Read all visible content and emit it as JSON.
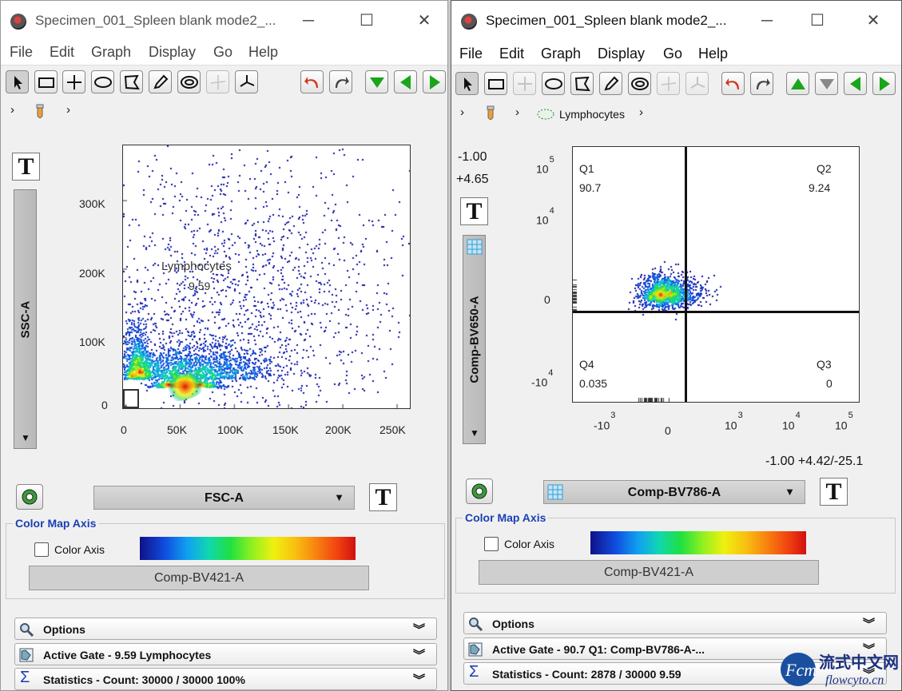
{
  "win1": {
    "title": "Specimen_001_Spleen blank mode2_...",
    "menu": [
      "File",
      "Edit",
      "Graph",
      "Display",
      "Go",
      "Help"
    ],
    "crumb_arrows": [
      "›",
      "›"
    ],
    "yaxis_label": "SSC-A",
    "xaxis_label": "FSC-A",
    "gate_name": "Lymphocytes",
    "gate_pct": "9.59",
    "color_map_title": "Color Map Axis",
    "color_axis_label": "Color Axis",
    "color_param": "Comp-BV421-A",
    "options_label": "Options",
    "active_gate_label": "Active Gate  -  9.59 Lymphocytes",
    "statistics_label": "Statistics  -  Count: 30000 / 30000       100%"
  },
  "win2": {
    "title": "Specimen_001_Spleen blank mode2_...",
    "menu": [
      "File",
      "Edit",
      "Graph",
      "Display",
      "Go",
      "Help"
    ],
    "crumb_arrows": [
      "›",
      "›",
      "›"
    ],
    "crumb_population": "Lymphocytes",
    "readout_y1": "-1.00",
    "readout_y2": "+4.65",
    "readout_x": "-1.00 +4.42/-25.1",
    "yaxis_label": "Comp-BV650-A",
    "xaxis_label": "Comp-BV786-A",
    "quadrants": {
      "q1_name": "Q1",
      "q1_pct": "90.7",
      "q2_name": "Q2",
      "q2_pct": "9.24",
      "q3_name": "Q3",
      "q3_pct": "0",
      "q4_name": "Q4",
      "q4_pct": "0.035"
    },
    "color_map_title": "Color Map Axis",
    "color_axis_label": "Color Axis",
    "color_param": "Comp-BV421-A",
    "options_label": "Options",
    "active_gate_label": "Active Gate  -  90.7 Q1: Comp-BV786-A-...",
    "statistics_label": "Statistics  -  Count: 2878 / 30000       9.59"
  },
  "chart_data": [
    {
      "type": "scatter",
      "xlabel": "FSC-A",
      "ylabel": "SSC-A",
      "x_ticks": [
        "0",
        "50K",
        "100K",
        "150K",
        "200K",
        "250K"
      ],
      "y_ticks": [
        "0",
        "100K",
        "200K",
        "300K"
      ],
      "xlim": [
        0,
        262144
      ],
      "ylim": [
        0,
        380000
      ],
      "density": [
        {
          "x": 55000,
          "y": 28000,
          "spread_x": 14000,
          "spread_y": 9000,
          "n": 900
        },
        {
          "x": 60000,
          "y": 40000,
          "spread_x": 40000,
          "spread_y": 40000,
          "n": 1600
        },
        {
          "x": 10000,
          "y": 40000,
          "spread_x": 8000,
          "spread_y": 60000,
          "n": 700
        },
        {
          "x": 110000,
          "y": 160000,
          "spread_x": 80000,
          "spread_y": 110000,
          "n": 1500
        }
      ],
      "gates": [
        {
          "name": "Lymphocytes",
          "value": 9.59
        }
      ]
    },
    {
      "type": "scatter",
      "xlabel": "Comp-BV786-A",
      "ylabel": "Comp-BV650-A",
      "x_ticks": [
        "-10^3",
        "0",
        "10^3",
        "10^4",
        "10^5"
      ],
      "y_ticks": [
        "10^5",
        "10^4",
        "0",
        "-10^4"
      ],
      "quadrants": {
        "Q1": 90.7,
        "Q2": 9.24,
        "Q3": 0,
        "Q4": 0.035
      },
      "density": [
        {
          "x": 0,
          "y": 0,
          "spread_x": 1,
          "spread_y": 1,
          "n": 900
        }
      ]
    }
  ],
  "colors": {
    "accent": "#1a3fb5",
    "green_arrow": "#1aa51a",
    "undo_red": "#d0381a"
  }
}
